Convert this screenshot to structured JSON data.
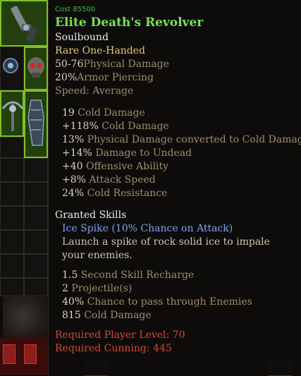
{
  "item": {
    "cost_label": "Cost",
    "cost_value": "85500",
    "name": "Elite Death's Revolver",
    "binding": "Soulbound",
    "rarity": "Rare One-Handed",
    "base_stats": [
      {
        "value": "50-76",
        "label": "Physical Damage"
      },
      {
        "value": "20%",
        "label": "Armor Piercing"
      },
      {
        "label": "Speed:",
        "value": "Average"
      }
    ],
    "bonus_stats": [
      {
        "value": "19",
        "label": "Cold Damage"
      },
      {
        "value": "+118%",
        "label": "Cold Damage"
      },
      {
        "value": "13%",
        "label": "Physical Damage converted to Cold Damage"
      },
      {
        "value": "+14%",
        "label": "Damage to Undead"
      },
      {
        "value": "+40",
        "label": "Offensive Ability"
      },
      {
        "value": "+8%",
        "label": "Attack Speed"
      },
      {
        "value": "24%",
        "label": "Cold Resistance"
      }
    ],
    "granted_skills_header": "Granted Skills",
    "skill_name": "Ice Spike (10% Chance on Attack)",
    "skill_description": "Launch a spike of rock solid ice to impale your enemies.",
    "skill_stats": [
      {
        "value": "1.5",
        "label": "Second Skill Recharge"
      },
      {
        "value": "2",
        "label": "Projectile(s)"
      },
      {
        "value": "40%",
        "label": "Chance to pass through Enemies"
      },
      {
        "value": "815",
        "label": "Cold Damage"
      }
    ],
    "requirements": [
      "Required Player Level: 70",
      "Required Cunning: 445"
    ]
  },
  "icons": {
    "revolver": "revolver-icon",
    "amulet": "amulet-icon",
    "skull": "skull-icon",
    "crossbow": "crossbow-icon",
    "gauntlet": "gauntlet-icon"
  },
  "colors": {
    "item_name": "#76e25a",
    "cost": "#4fb84a",
    "rarity": "#e9c879",
    "stat_label": "#a08d6a",
    "skill_name": "#7ea2ec",
    "requirement": "#d14a3a",
    "highlight_slot": "#7fbf2a"
  }
}
